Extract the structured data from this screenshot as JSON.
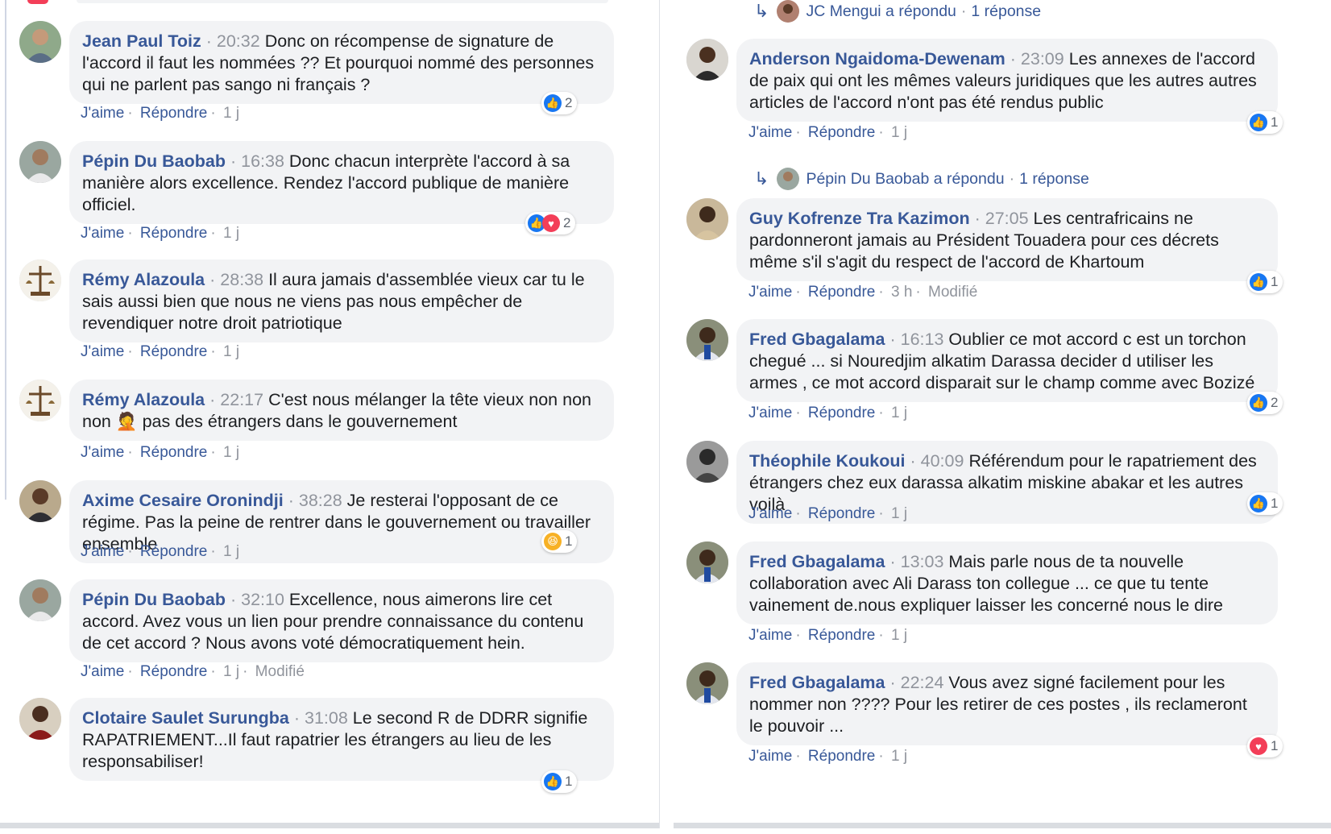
{
  "left": {
    "comments": [
      {
        "author": "Jean Paul Toiz",
        "time": "20:32",
        "text": "Donc on récompense de signature de l'accord il faut les nommées ?? Et pourquoi nommé des personnes qui ne parlent pas sango ni français ?",
        "like": "J'aime",
        "reply": "Répondre",
        "age": "1 j",
        "edited": "",
        "reactions": "2",
        "reaction_types": [
          "like"
        ]
      },
      {
        "author": "Pépin Du Baobab",
        "time": "16:38",
        "text": "Donc chacun interprète l'accord à sa manière alors excellence. Rendez l'accord publique de manière officiel.",
        "like": "J'aime",
        "reply": "Répondre",
        "age": "1 j",
        "edited": "",
        "reactions": "2",
        "reaction_types": [
          "like",
          "love"
        ]
      },
      {
        "author": "Rémy Alazoula",
        "time": "28:38",
        "text": "Il aura jamais d'assemblée vieux car tu le sais aussi bien que nous ne viens pas nous empêcher de revendiquer notre droit patriotique",
        "like": "J'aime",
        "reply": "Répondre",
        "age": "1 j",
        "edited": "",
        "reactions": "",
        "reaction_types": []
      },
      {
        "author": "Rémy Alazoula",
        "time": "22:17",
        "text": "C'est nous mélanger la tête vieux non non non 🤦 pas des étrangers dans le gouvernement",
        "like": "J'aime",
        "reply": "Répondre",
        "age": "1 j",
        "edited": "",
        "reactions": "",
        "reaction_types": []
      },
      {
        "author": "Axime Cesaire Oronindji",
        "time": "38:28",
        "text": "Je resterai l'opposant de ce régime. Pas la peine de rentrer dans le gouvernement ou travailler ensemble",
        "like": "J'aime",
        "reply": "Répondre",
        "age": "1 j",
        "edited": "",
        "reactions": "1",
        "reaction_types": [
          "haha"
        ]
      },
      {
        "author": "Pépin Du Baobab",
        "time": "32:10",
        "text": "Excellence, nous aimerons lire cet accord. Avez vous un lien pour prendre connaissance du contenu de cet accord ? Nous avons voté démocratiquement hein.",
        "like": "J'aime",
        "reply": "Répondre",
        "age": "1 j",
        "edited": "Modifié",
        "reactions": "",
        "reaction_types": []
      },
      {
        "author": "Clotaire Saulet Surungba",
        "time": "31:08",
        "text": "Le second R de DDRR signifie RAPATRIEMENT...Il faut rapatrier les étrangers au lieu de les responsabiliser!",
        "like": "",
        "reply": "",
        "age": "",
        "edited": "",
        "reactions": "1",
        "reaction_types": [
          "like"
        ]
      }
    ]
  },
  "right": {
    "top_reply": {
      "text": "JC Mengui a répondu",
      "count": "1 réponse"
    },
    "comments": [
      {
        "author": "Anderson Ngaidoma-Dewenam",
        "time": "23:09",
        "text": "Les annexes de l'accord de paix qui ont les mêmes valeurs juridiques que les autres autres articles de l'accord n'ont pas été rendus public",
        "like": "J'aime",
        "reply": "Répondre",
        "age": "1 j",
        "edited": "",
        "reactions": "1",
        "reaction_types": [
          "like"
        ]
      },
      {
        "author": "Guy Kofrenze Tra Kazimon",
        "time": "27:05",
        "text": "Les centrafricains ne pardonneront jamais au Président Touadera pour ces décrets même s'il s'agit du respect de l'accord de Khartoum",
        "like": "J'aime",
        "reply": "Répondre",
        "age": "3 h",
        "edited": "Modifié",
        "reactions": "1",
        "reaction_types": [
          "like"
        ]
      },
      {
        "author": "Fred Gbagalama",
        "time": "16:13",
        "text": "Oublier ce mot accord c est un torchon chegué ... si Nouredjim alkatim Darassa decider d utiliser les armes , ce mot accord disparait sur le champ comme avec Bozizé",
        "like": "J'aime",
        "reply": "Répondre",
        "age": "1 j",
        "edited": "",
        "reactions": "2",
        "reaction_types": [
          "like"
        ]
      },
      {
        "author": "Théophile Koukoui",
        "time": "40:09",
        "text": "Référendum pour le rapatriement des étrangers chez eux darassa alkatim miskine abakar et les autres voilà",
        "like": "J'aime",
        "reply": "Répondre",
        "age": "1 j",
        "edited": "",
        "reactions": "1",
        "reaction_types": [
          "like"
        ]
      },
      {
        "author": "Fred Gbagalama",
        "time": "13:03",
        "text": "Mais parle nous de ta nouvelle collaboration avec Ali Darass ton collegue ... ce que tu tente vainement de.nous expliquer laisser les concerné nous le dire",
        "like": "J'aime",
        "reply": "Répondre",
        "age": "1 j",
        "edited": "",
        "reactions": "",
        "reaction_types": []
      },
      {
        "author": "Fred Gbagalama",
        "time": "22:24",
        "text": "Vous avez signé facilement pour les nommer non ???? Pour les retirer de ces postes , ils reclameront le pouvoir ...",
        "like": "J'aime",
        "reply": "Répondre",
        "age": "1 j",
        "edited": "",
        "reactions": "1",
        "reaction_types": [
          "love"
        ]
      }
    ],
    "mid_reply": {
      "text": "Pépin Du Baobab a répondu",
      "count": "1 réponse"
    }
  },
  "colors": {
    "link": "#385898",
    "bubble": "#f2f3f5",
    "meta": "#90949c",
    "like": "#1877f2",
    "love": "#f33e58",
    "haha": "#f7b125"
  }
}
